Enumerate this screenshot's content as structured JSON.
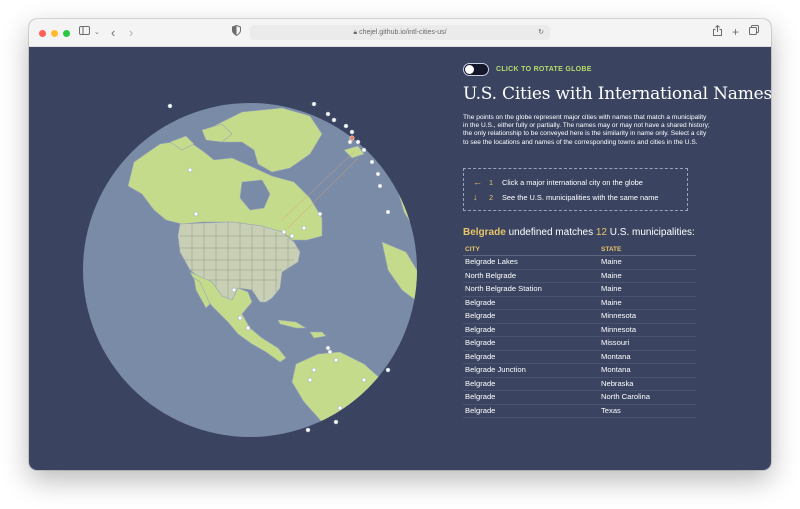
{
  "browser": {
    "url": "chejel.github.io/intl-cities-us/",
    "colors": {
      "close": "#ff5f57",
      "minimize": "#febc2e",
      "maximize": "#28c840"
    }
  },
  "toggle": {
    "label": "CLICK TO ROTATE GLOBE",
    "on": false
  },
  "title": "U.S. Cities with International Names",
  "description": "The points on the globe represent major cities with names that match a municipality in the U.S., either fully or partially. The names may or may not have a shared history; the only relationship to be conveyed here is the similarity in name only. Select a city to see the locations and names of the corresponding towns and cities in the U.S.",
  "steps": [
    {
      "icon": "arrow-left-icon",
      "glyph": "←",
      "num": "1",
      "text": "Click a major international city on the globe"
    },
    {
      "icon": "arrow-down-icon",
      "glyph": "↓",
      "num": "2",
      "text": "See the U.S. municipalities with the same name"
    }
  ],
  "selection": {
    "city": "Belgrade",
    "country": "undefined",
    "matches_word": "matches",
    "count": "12",
    "suffix": "U.S. municipalities:"
  },
  "table": {
    "headers": [
      "CITY",
      "STATE"
    ],
    "rows": [
      [
        "Belgrade Lakes",
        "Maine"
      ],
      [
        "North Belgrade",
        "Maine"
      ],
      [
        "North Belgrade Station",
        "Maine"
      ],
      [
        "Belgrade",
        "Maine"
      ],
      [
        "Belgrade",
        "Minnesota"
      ],
      [
        "Belgrade",
        "Minnesota"
      ],
      [
        "Belgrade",
        "Missouri"
      ],
      [
        "Belgrade",
        "Montana"
      ],
      [
        "Belgrade Junction",
        "Montana"
      ],
      [
        "Belgrade",
        "Nebraska"
      ],
      [
        "Belgrade",
        "North Carolina"
      ],
      [
        "Belgrade",
        "Texas"
      ]
    ]
  },
  "colors": {
    "background": "#3a4461",
    "ocean": "#7a8ba8",
    "land": "#c5db8c",
    "usa": "#c9cfb5",
    "accent": "#e8c468",
    "toggle_label": "#b7dc6a"
  }
}
